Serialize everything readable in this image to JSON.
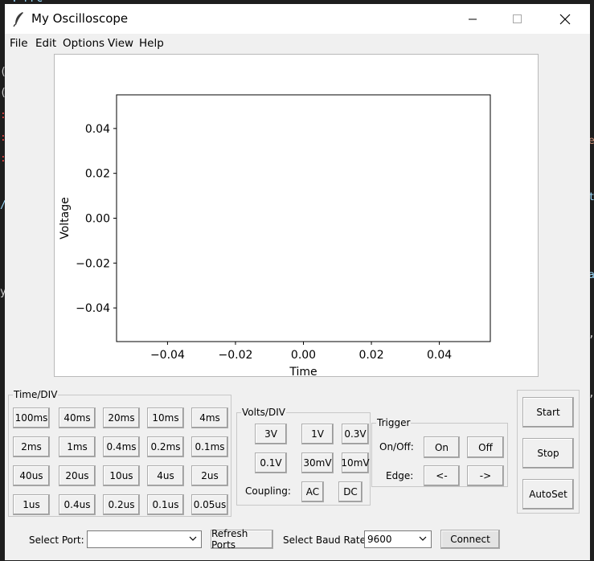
{
  "window": {
    "title": "My Oscilloscope"
  },
  "menu": [
    "File",
    "Edit",
    "Options",
    "View",
    "Help"
  ],
  "chart_data": {
    "type": "line",
    "title": "",
    "xlabel": "Time",
    "ylabel": "Voltage",
    "xlim": [
      -0.055,
      0.055
    ],
    "ylim": [
      -0.055,
      0.055
    ],
    "x_ticks": [
      -0.04,
      -0.02,
      0.0,
      0.02,
      0.04
    ],
    "x_tick_labels": [
      "−0.04",
      "−0.02",
      "0.00",
      "0.02",
      "0.04"
    ],
    "y_ticks": [
      0.04,
      0.02,
      0.0,
      -0.02,
      -0.04
    ],
    "y_tick_labels": [
      "0.04",
      "0.02",
      "0.00",
      "−0.02",
      "−0.04"
    ],
    "series": [],
    "grid": false
  },
  "time_div": {
    "label": "Time/DIV",
    "rows": [
      [
        "100ms",
        "40ms",
        "20ms",
        "10ms",
        "4ms"
      ],
      [
        "2ms",
        "1ms",
        "0.4ms",
        "0.2ms",
        "0.1ms"
      ],
      [
        "40us",
        "20us",
        "10us",
        "4us",
        "2us"
      ],
      [
        "1us",
        "0.4us",
        "0.2us",
        "0.1us",
        "0.05us"
      ]
    ]
  },
  "volts_div": {
    "label": "Volts/DIV",
    "rows": [
      [
        "3V",
        "1V",
        "0.3V"
      ],
      [
        "0.1V",
        "30mV",
        "10mV"
      ]
    ],
    "coupling_label": "Coupling:",
    "coupling": [
      "AC",
      "DC"
    ]
  },
  "trigger": {
    "label": "Trigger",
    "onoff_label": "On/Off:",
    "on": "On",
    "off": "Off",
    "edge_label": "Edge:",
    "edge_left": "<-",
    "edge_right": "->"
  },
  "controls": {
    "start": "Start",
    "stop": "Stop",
    "autoset": "AutoSet"
  },
  "bottom": {
    "port_label": "Select Port:",
    "port_value": "",
    "refresh": "Refresh Ports",
    "baud_label": "Select Baud Rate:",
    "baud_value": "9600",
    "connect": "Connect"
  },
  "colors": {
    "window_bg": "#f0f0f0",
    "plot_bg": "#ffffff",
    "editor_bg": "#1e1e1e",
    "axis": "#000000"
  }
}
